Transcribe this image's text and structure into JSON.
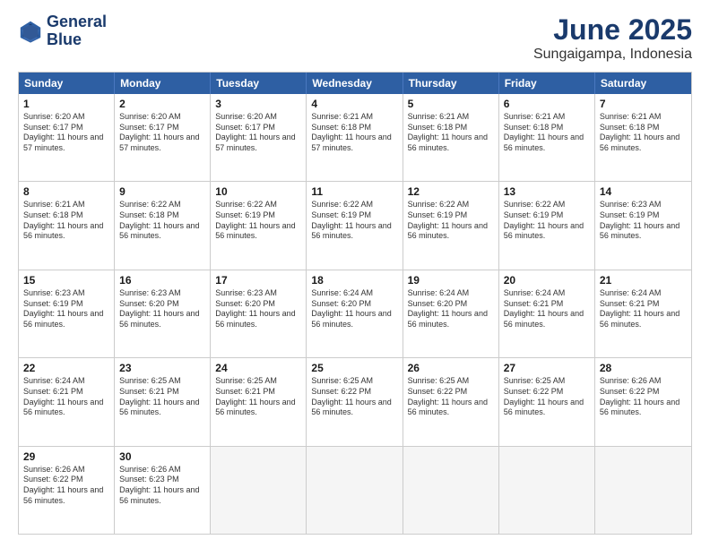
{
  "logo": {
    "line1": "General",
    "line2": "Blue"
  },
  "title": "June 2025",
  "subtitle": "Sungaigampa, Indonesia",
  "weekdays": [
    "Sunday",
    "Monday",
    "Tuesday",
    "Wednesday",
    "Thursday",
    "Friday",
    "Saturday"
  ],
  "weeks": [
    [
      {
        "day": 1,
        "sunrise": "6:20 AM",
        "sunset": "6:17 PM",
        "daylight": "11 hours and 57 minutes."
      },
      {
        "day": 2,
        "sunrise": "6:20 AM",
        "sunset": "6:17 PM",
        "daylight": "11 hours and 57 minutes."
      },
      {
        "day": 3,
        "sunrise": "6:20 AM",
        "sunset": "6:17 PM",
        "daylight": "11 hours and 57 minutes."
      },
      {
        "day": 4,
        "sunrise": "6:21 AM",
        "sunset": "6:18 PM",
        "daylight": "11 hours and 57 minutes."
      },
      {
        "day": 5,
        "sunrise": "6:21 AM",
        "sunset": "6:18 PM",
        "daylight": "11 hours and 56 minutes."
      },
      {
        "day": 6,
        "sunrise": "6:21 AM",
        "sunset": "6:18 PM",
        "daylight": "11 hours and 56 minutes."
      },
      {
        "day": 7,
        "sunrise": "6:21 AM",
        "sunset": "6:18 PM",
        "daylight": "11 hours and 56 minutes."
      }
    ],
    [
      {
        "day": 8,
        "sunrise": "6:21 AM",
        "sunset": "6:18 PM",
        "daylight": "11 hours and 56 minutes."
      },
      {
        "day": 9,
        "sunrise": "6:22 AM",
        "sunset": "6:18 PM",
        "daylight": "11 hours and 56 minutes."
      },
      {
        "day": 10,
        "sunrise": "6:22 AM",
        "sunset": "6:19 PM",
        "daylight": "11 hours and 56 minutes."
      },
      {
        "day": 11,
        "sunrise": "6:22 AM",
        "sunset": "6:19 PM",
        "daylight": "11 hours and 56 minutes."
      },
      {
        "day": 12,
        "sunrise": "6:22 AM",
        "sunset": "6:19 PM",
        "daylight": "11 hours and 56 minutes."
      },
      {
        "day": 13,
        "sunrise": "6:22 AM",
        "sunset": "6:19 PM",
        "daylight": "11 hours and 56 minutes."
      },
      {
        "day": 14,
        "sunrise": "6:23 AM",
        "sunset": "6:19 PM",
        "daylight": "11 hours and 56 minutes."
      }
    ],
    [
      {
        "day": 15,
        "sunrise": "6:23 AM",
        "sunset": "6:19 PM",
        "daylight": "11 hours and 56 minutes."
      },
      {
        "day": 16,
        "sunrise": "6:23 AM",
        "sunset": "6:20 PM",
        "daylight": "11 hours and 56 minutes."
      },
      {
        "day": 17,
        "sunrise": "6:23 AM",
        "sunset": "6:20 PM",
        "daylight": "11 hours and 56 minutes."
      },
      {
        "day": 18,
        "sunrise": "6:24 AM",
        "sunset": "6:20 PM",
        "daylight": "11 hours and 56 minutes."
      },
      {
        "day": 19,
        "sunrise": "6:24 AM",
        "sunset": "6:20 PM",
        "daylight": "11 hours and 56 minutes."
      },
      {
        "day": 20,
        "sunrise": "6:24 AM",
        "sunset": "6:21 PM",
        "daylight": "11 hours and 56 minutes."
      },
      {
        "day": 21,
        "sunrise": "6:24 AM",
        "sunset": "6:21 PM",
        "daylight": "11 hours and 56 minutes."
      }
    ],
    [
      {
        "day": 22,
        "sunrise": "6:24 AM",
        "sunset": "6:21 PM",
        "daylight": "11 hours and 56 minutes."
      },
      {
        "day": 23,
        "sunrise": "6:25 AM",
        "sunset": "6:21 PM",
        "daylight": "11 hours and 56 minutes."
      },
      {
        "day": 24,
        "sunrise": "6:25 AM",
        "sunset": "6:21 PM",
        "daylight": "11 hours and 56 minutes."
      },
      {
        "day": 25,
        "sunrise": "6:25 AM",
        "sunset": "6:22 PM",
        "daylight": "11 hours and 56 minutes."
      },
      {
        "day": 26,
        "sunrise": "6:25 AM",
        "sunset": "6:22 PM",
        "daylight": "11 hours and 56 minutes."
      },
      {
        "day": 27,
        "sunrise": "6:25 AM",
        "sunset": "6:22 PM",
        "daylight": "11 hours and 56 minutes."
      },
      {
        "day": 28,
        "sunrise": "6:26 AM",
        "sunset": "6:22 PM",
        "daylight": "11 hours and 56 minutes."
      }
    ],
    [
      {
        "day": 29,
        "sunrise": "6:26 AM",
        "sunset": "6:22 PM",
        "daylight": "11 hours and 56 minutes."
      },
      {
        "day": 30,
        "sunrise": "6:26 AM",
        "sunset": "6:23 PM",
        "daylight": "11 hours and 56 minutes."
      },
      null,
      null,
      null,
      null,
      null
    ]
  ]
}
